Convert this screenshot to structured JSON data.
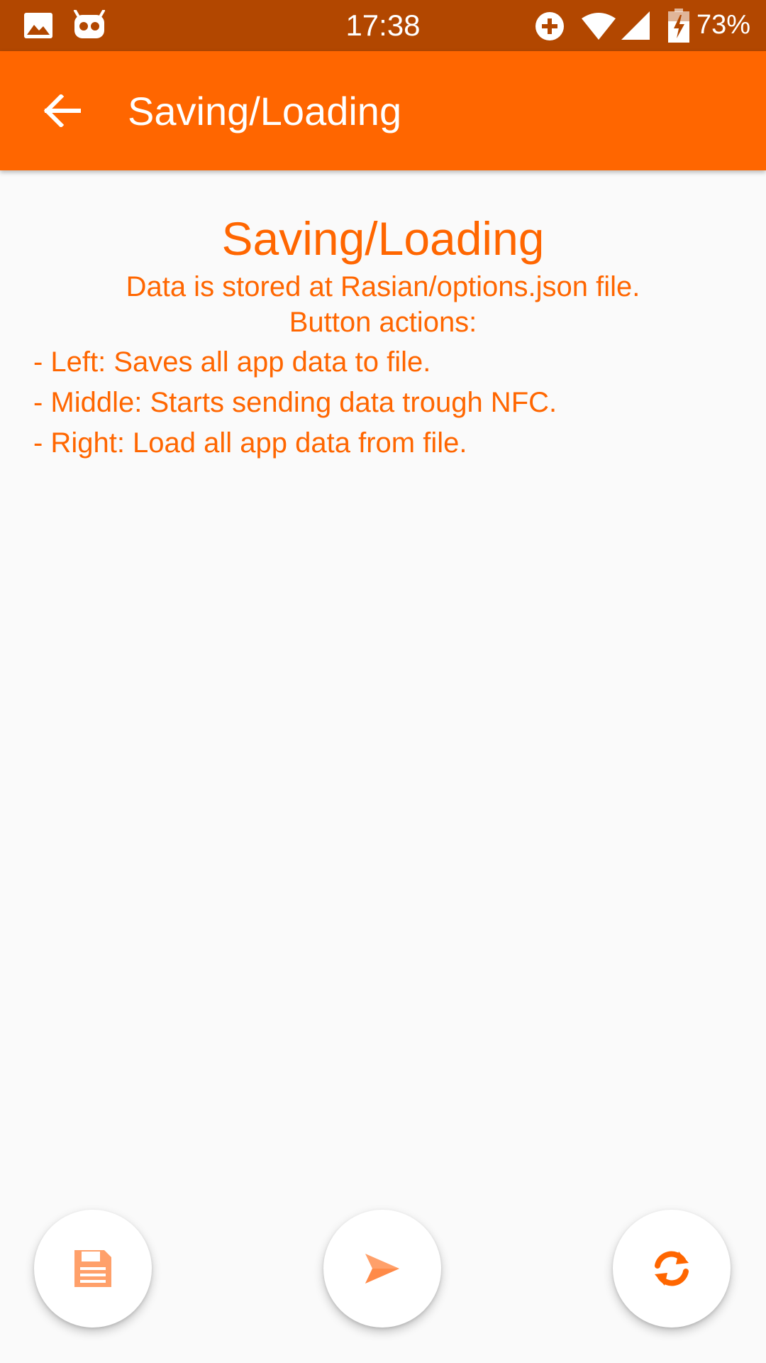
{
  "status_bar": {
    "time": "17:38",
    "battery_percent": "73%",
    "icons": [
      "image-icon",
      "android-bot-icon",
      "data-saver-icon",
      "wifi-icon",
      "signal-icon",
      "battery-charging-icon"
    ]
  },
  "app_bar": {
    "title": "Saving/Loading",
    "back_icon": "arrow-back-icon"
  },
  "content": {
    "heading": "Saving/Loading",
    "description": "Data is stored at Rasian/options.json file.",
    "actions_label": "Button actions:",
    "actions": [
      "- Left: Saves all app data to file.",
      "- Middle: Starts sending data trough NFC.",
      "- Right: Load all app data from file."
    ]
  },
  "buttons": {
    "left_icon": "floppy-disk-icon",
    "middle_icon": "send-icon",
    "right_icon": "refresh-icon"
  },
  "colors": {
    "status_bar": "#b24700",
    "accent": "#ff6600",
    "background": "#fafafa",
    "fab_background": "#ffffff"
  }
}
